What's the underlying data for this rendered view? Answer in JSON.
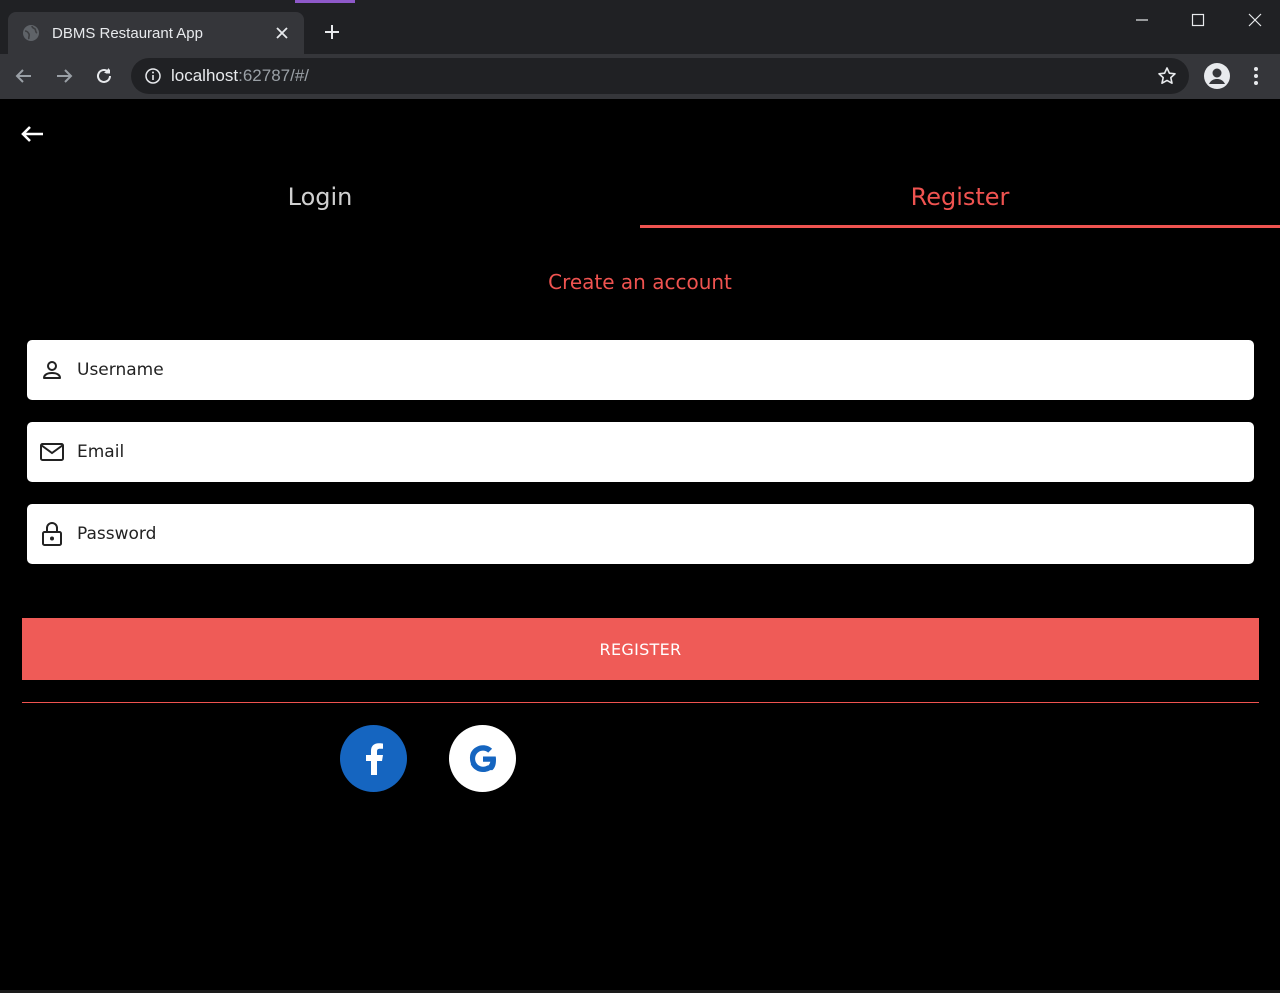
{
  "browser": {
    "tab_title": "DBMS Restaurant App",
    "url_host": "localhost",
    "url_rest": ":62787/#/"
  },
  "app": {
    "tabs": [
      {
        "label": "Login",
        "active": false
      },
      {
        "label": "Register",
        "active": true
      }
    ],
    "heading": "Create an account",
    "fields": {
      "username_placeholder": "Username",
      "email_placeholder": "Email",
      "password_placeholder": "Password"
    },
    "register_label": "REGISTER",
    "social": [
      {
        "icon": "facebook-icon"
      },
      {
        "icon": "google-icon"
      }
    ]
  },
  "colors": {
    "accent": "#ef5350",
    "button": "#ef5b57",
    "facebook": "#1565c0",
    "background": "#000000"
  }
}
